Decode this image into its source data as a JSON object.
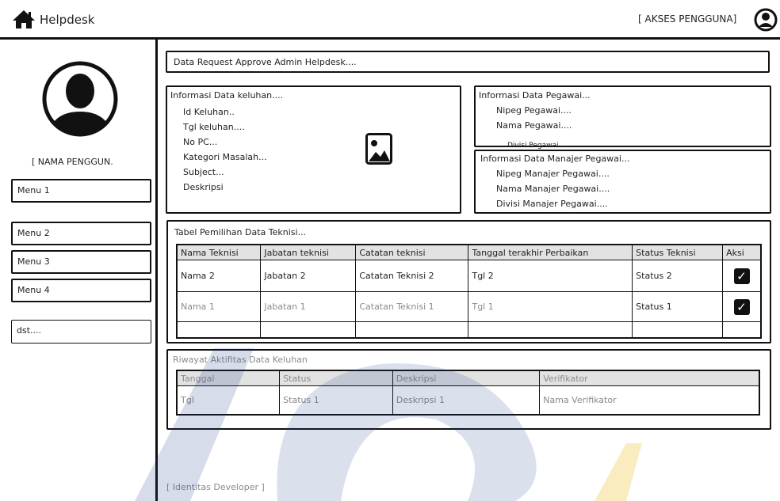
{
  "header": {
    "app_title": "Helpdesk",
    "access_label": "[ AKSES PENGGUNA]",
    "home_icon": "home-icon",
    "user_icon": "user-circle-icon"
  },
  "sidebar": {
    "user_name": "[ NAMA PENGGUN.",
    "avatar_icon": "avatar-icon",
    "menu": [
      "Menu 1",
      "Menu 2",
      "Menu 3",
      "Menu 4",
      "dst...."
    ]
  },
  "main": {
    "page_heading": "Data Request Approve Admin Helpdesk....",
    "complaint": {
      "title": "Informasi Data keluhan....",
      "fields": [
        "Id Keluhan..",
        "Tgl keluhan....",
        "No PC...",
        "Kategori Masalah...",
        "Subject...",
        "Deskripsi"
      ],
      "image_icon": "image-placeholder-icon"
    },
    "employee": {
      "title": "Informasi Data Pegawai...",
      "fields": [
        "Nipeg Pegawai....",
        "Nama Pegawai...."
      ],
      "hidden_field": "Divisi Pegawai..."
    },
    "manager": {
      "title": "Informasi Data Manajer Pegawai...",
      "fields": [
        "Nipeg Manajer Pegawai....",
        "Nama Manajer Pegawai....",
        "Divisi Manajer Pegawai...."
      ]
    },
    "tech_table": {
      "title": "Tabel Pemilihan Data Teknisi...",
      "columns": [
        "Nama Teknisi",
        "Jabatan teknisi",
        "Catatan teknisi",
        "Tanggal terakhir Perbaikan",
        "Status Teknisi",
        "Aksi"
      ],
      "rows": [
        [
          "Nama 2",
          "Jabatan 2",
          "Catatan Teknisi 2",
          "Tgl 2",
          "Status 2"
        ],
        [
          "Nama 1",
          "Jabatan 1",
          "Catatan Teknisi 1",
          "Tgl 1",
          "Status 1"
        ]
      ]
    },
    "history": {
      "title": "Riwayat Aktifitas Data Keluhan",
      "columns": [
        "Tanggal",
        "Status",
        "Deskripsi",
        "Verifikator"
      ],
      "rows": [
        [
          "Tgl",
          "Status 1",
          "Deskripsi 1",
          "Nama Verifikator"
        ]
      ]
    },
    "footer": "[ Identitas Developer ]"
  }
}
